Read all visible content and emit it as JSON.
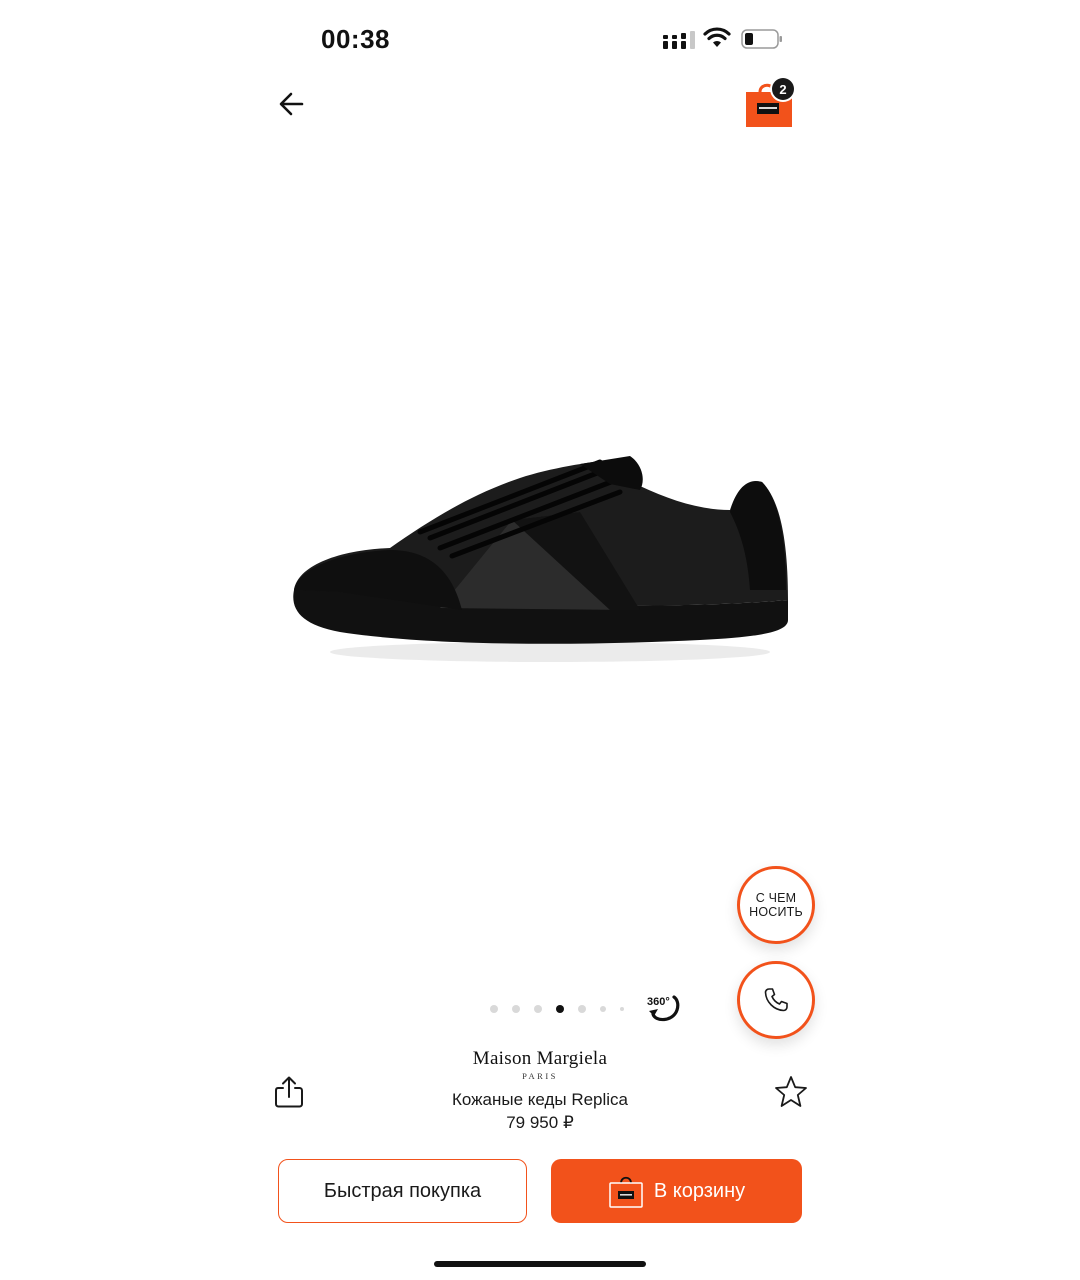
{
  "status_bar": {
    "time": "00:38"
  },
  "cart": {
    "badge_count": "2"
  },
  "floating": {
    "outfit_label": "С ЧЕМ НОСИТЬ"
  },
  "carousel": {
    "total_slides": 7,
    "active_index": 3,
    "view360_label": "360°"
  },
  "product": {
    "brand": "Maison Margiela",
    "brand_sub": "PARIS",
    "title": "Кожаные кеды Replica",
    "price": "79 950 ₽"
  },
  "actions": {
    "quick_buy_label": "Быстрая покупка",
    "add_to_cart_label": "В корзину"
  },
  "colors": {
    "accent": "#f2521b",
    "text": "#111111"
  },
  "icons": [
    "arrow-left-icon",
    "shopping-bag-icon",
    "phone-icon",
    "share-icon",
    "star-icon",
    "360-rotate-icon"
  ]
}
